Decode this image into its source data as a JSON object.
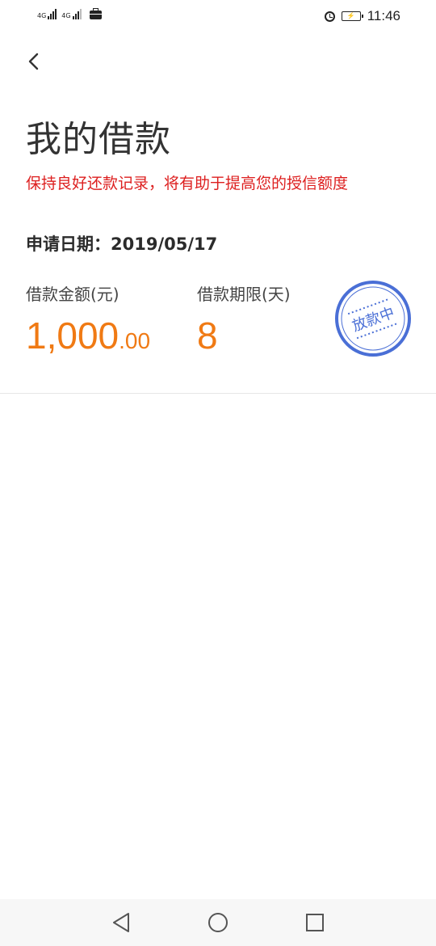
{
  "statusbar": {
    "net1": "4G",
    "net2": "4G",
    "time": "11:46"
  },
  "page": {
    "title": "我的借款",
    "tip": "保持良好还款记录，将有助于提高您的授信额度"
  },
  "loan": {
    "apply_date_label": "申请日期：",
    "apply_date": "2019/05/17",
    "amount_label": "借款金额(元)",
    "amount_integer": "1,000",
    "amount_decimal": ".00",
    "term_label": "借款期限(天)",
    "term_value": "8",
    "status_stamp": "放款中"
  },
  "colors": {
    "accent_orange": "#f07a14",
    "tip_red": "#dd1f1f",
    "stamp_blue": "#4a6fd6"
  },
  "icons": {
    "back": "chevron-left-icon",
    "nav_back": "triangle-back-icon",
    "nav_home": "circle-home-icon",
    "nav_recent": "square-recent-icon"
  }
}
